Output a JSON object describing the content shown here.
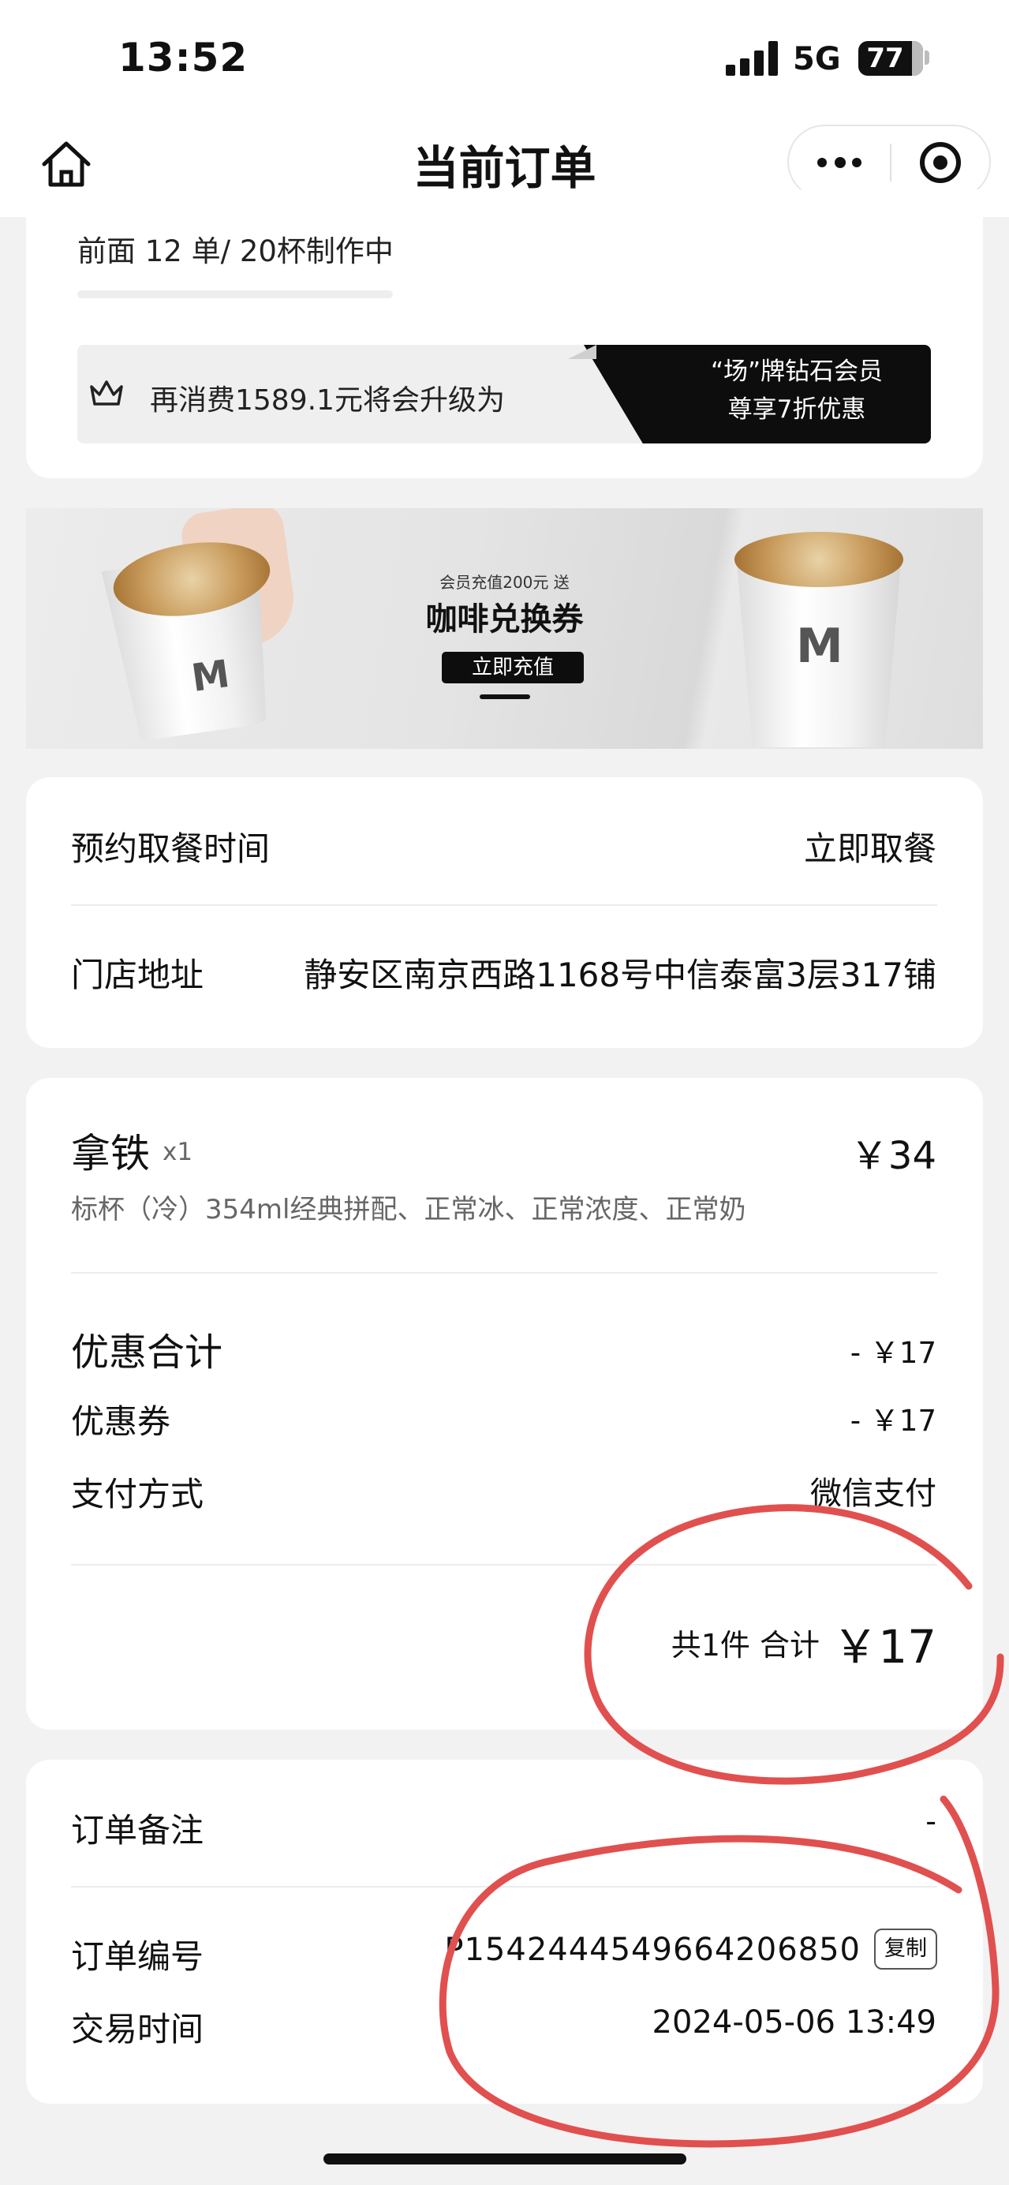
{
  "status_bar": {
    "time": "13:52",
    "network": "5G",
    "battery": "77",
    "battery_level_percent": 77
  },
  "nav": {
    "title": "当前订单",
    "home_icon": "home-icon",
    "more_icon": "more-dots-icon",
    "close_icon": "target-icon"
  },
  "queue": {
    "text": "前面 12 单/ 20杯制作中"
  },
  "member": {
    "upgrade_text": "再消费1589.1元将会升级为",
    "tier_line1": "“场”牌钻石会员",
    "tier_line2": "尊享7折优惠",
    "icon": "crown-icon"
  },
  "banner": {
    "subtitle": "会员充值200元 送",
    "title": "咖啡兑换券",
    "button": "立即充值",
    "cup_logo": "M"
  },
  "pickup": {
    "time_label": "预约取餐时间",
    "time_value": "立即取餐",
    "address_label": "门店地址",
    "address_value": "静安区南京西路1168号中信泰富3层317铺"
  },
  "order_item": {
    "name": "拿铁",
    "qty": "x1",
    "price": "￥34",
    "spec": "标杯（冷）354ml经典拼配、正常冰、正常浓度、正常奶"
  },
  "summary": {
    "discount_total_label": "优惠合计",
    "discount_total_value": "- ￥17",
    "coupon_label": "优惠券",
    "coupon_value": "- ￥17",
    "payment_label": "支付方式",
    "payment_value": "微信支付",
    "count_text": "共1件 合计",
    "total": "￥17"
  },
  "order_info": {
    "remark_label": "订单备注",
    "remark_value": "-",
    "number_label": "订单编号",
    "number_value": "P1542444549664206850",
    "copy_button": "复制",
    "time_label": "交易时间",
    "time_value": "2024-05-06 13:49"
  },
  "colors": {
    "accent_black": "#0d0d0d",
    "annotation_red": "#e0504f",
    "page_bg": "#f2f2f2"
  }
}
